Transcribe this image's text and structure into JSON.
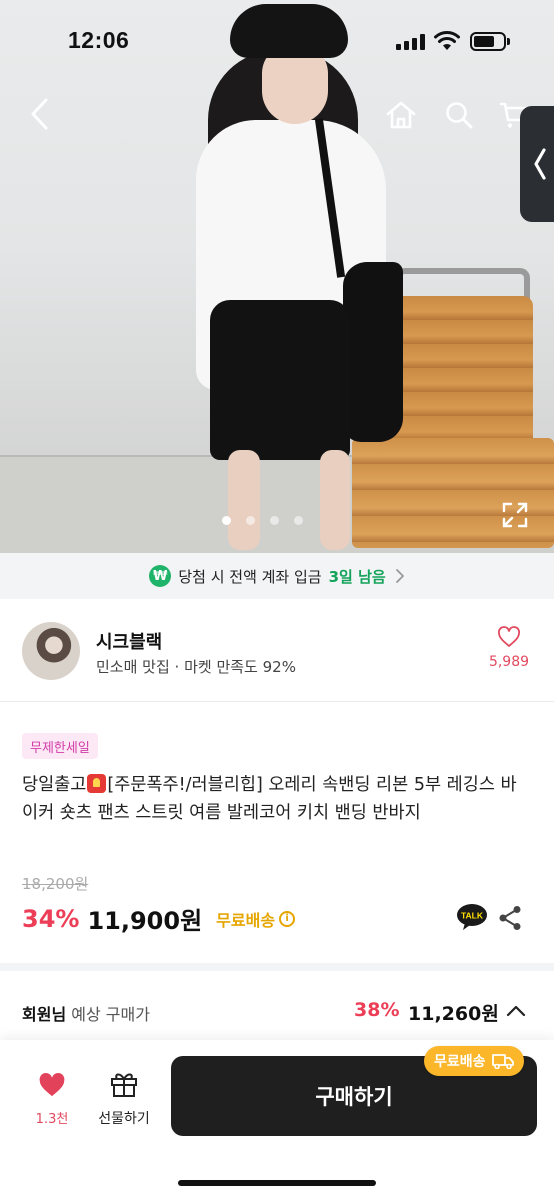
{
  "status_bar": {
    "time": "12:06"
  },
  "hero": {
    "image_alt": "product photo",
    "slide_count": 4,
    "active_slide": 1
  },
  "nav": {
    "back_icon": "chevron-left-icon",
    "home_icon": "home-icon",
    "search_icon": "search-icon",
    "cart_icon": "cart-icon",
    "side_tab_icon": "chevron-left-icon"
  },
  "notice": {
    "icon": "won-icon",
    "icon_text": "₩",
    "text": "당첨 시 전액 계좌 입금",
    "days_left": "3일 남음",
    "chevron_icon": "chevron-right-icon"
  },
  "seller": {
    "name": "시크블랙",
    "description": "민소매 맛집 · 마켓 만족도 92%",
    "like_count": "5,989",
    "like_icon": "heart-outline-icon"
  },
  "product": {
    "sale_badge": "무제한세일",
    "title_part1": "당일출고",
    "title_part2": "[주문폭주!/러블리힙] 오레리 속밴딩 리본 5부 레깅스 바이커 숏츠 팬츠 스트릿 여름 발레코어 키치 밴딩 반바지",
    "original_price": "18,200원",
    "discount": "34%",
    "price": "11,900원",
    "shipping": "무료배송",
    "info_icon_text": "i",
    "talk_text": "TALK"
  },
  "member_price": {
    "label_strong": "회원님",
    "label_rest": " 예상 구매가",
    "discount": "38%",
    "price": "11,260원"
  },
  "bottom_bar": {
    "like_label": "1.3천",
    "gift_label": "선물하기",
    "buy_label": "구매하기",
    "ship_tag": "무료배송"
  },
  "colors": {
    "accent_red": "#ec3e56",
    "shipping_yellow": "#e6a600",
    "tag_orange": "#fbb62a",
    "notice_green": "#13a35a",
    "buy_button": "#1f1f1f"
  }
}
